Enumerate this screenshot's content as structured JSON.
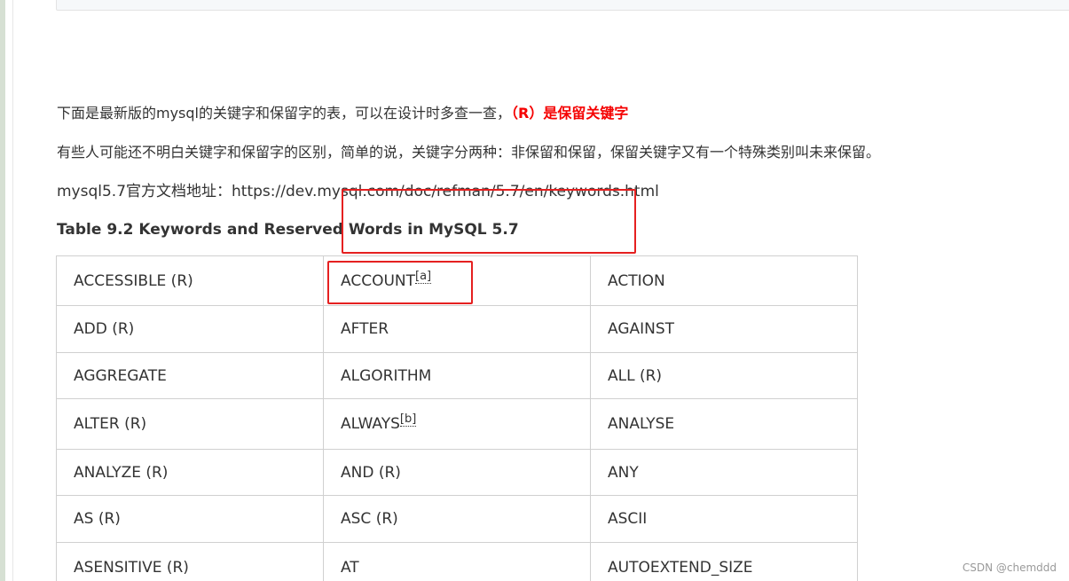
{
  "intro": {
    "line1": "下面是最新版的mysql的关键字和保留字的表，可以在设计时多查一查，",
    "line1_highlight": "（R）是保留关键字",
    "line2": "有些人可能还不明白关键字和保留字的区别，简单的说，关键字分两种：非保留和保留，保留关键字又有一个特殊类别叫未来保留。",
    "line3": "mysql5.7官方文档地址：https://dev.mysql.com/doc/refman/5.7/en/keywords.html"
  },
  "table": {
    "title": "Table 9.2 Keywords and Reserved Words in MySQL 5.7",
    "rows": [
      [
        {
          "text": "ACCESSIBLE (R)"
        },
        {
          "text": "ACCOUNT",
          "footnote": "[a]"
        },
        {
          "text": "ACTION"
        }
      ],
      [
        {
          "text": "ADD (R)"
        },
        {
          "text": "AFTER"
        },
        {
          "text": "AGAINST"
        }
      ],
      [
        {
          "text": "AGGREGATE"
        },
        {
          "text": "ALGORITHM"
        },
        {
          "text": "ALL (R)"
        }
      ],
      [
        {
          "text": "ALTER (R)"
        },
        {
          "text": "ALWAYS",
          "footnote": "[b]"
        },
        {
          "text": "ANALYSE"
        }
      ],
      [
        {
          "text": "ANALYZE (R)"
        },
        {
          "text": "AND (R)"
        },
        {
          "text": "ANY"
        }
      ],
      [
        {
          "text": "AS (R)"
        },
        {
          "text": "ASC (R)"
        },
        {
          "text": "ASCII"
        }
      ],
      [
        {
          "text": "ASENSITIVE (R)"
        },
        {
          "text": "AT"
        },
        {
          "text": "AUTOEXTEND_SIZE"
        }
      ]
    ]
  },
  "colors": {
    "highlight_red": "#f50000",
    "annotation_red": "#e52020",
    "text": "#333333"
  },
  "watermark": "CSDN @chemddd"
}
